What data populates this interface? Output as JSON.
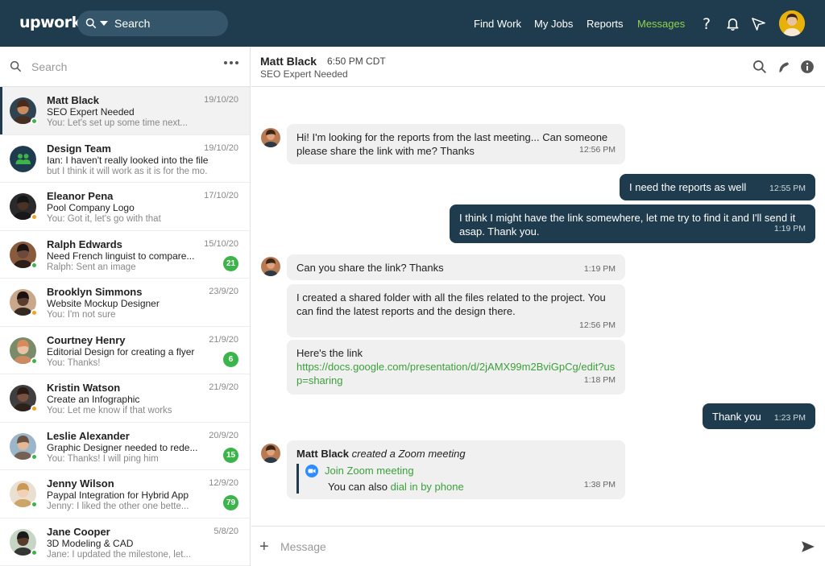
{
  "app": {
    "logo": "upwork",
    "search_placeholder": "Search",
    "nav": [
      "Find Work",
      "My Jobs",
      "Reports",
      "Messages"
    ],
    "active_nav": "Messages",
    "accent": "#1f3c4f",
    "highlight": "#8fd24a"
  },
  "sidebar": {
    "search_placeholder": "Search",
    "conversations": [
      {
        "name": "Matt Black",
        "date": "19/10/20",
        "subject": "SEO Expert Needed",
        "preview": "You: Let's set up some time next...",
        "status": "online",
        "badge": ""
      },
      {
        "name": "Design Team",
        "date": "19/10/20",
        "subject": "Ian: I haven't really looked into the file yet",
        "preview": "but I think it will work as it is for the mo...",
        "status": "",
        "badge": ""
      },
      {
        "name": "Eleanor Pena",
        "date": "17/10/20",
        "subject": "Pool Company Logo",
        "preview": "You: Got it, let's go with that",
        "status": "away",
        "badge": ""
      },
      {
        "name": "Ralph Edwards",
        "date": "15/10/20",
        "subject": "Need French linguist to compare...",
        "preview": "Ralph: Sent an image",
        "status": "online",
        "badge": "21"
      },
      {
        "name": "Brooklyn Simmons",
        "date": "23/9/20",
        "subject": "Website Mockup Designer",
        "preview": "You: I'm not sure",
        "status": "away",
        "badge": ""
      },
      {
        "name": "Courtney Henry",
        "date": "21/9/20",
        "subject": "Editorial Design for creating a flyer",
        "preview": "You: Thanks!",
        "status": "online",
        "badge": "6"
      },
      {
        "name": "Kristin Watson",
        "date": "21/9/20",
        "subject": "Create an Infographic",
        "preview": "You: Let me know if that works",
        "status": "away",
        "badge": ""
      },
      {
        "name": "Leslie Alexander",
        "date": "20/9/20",
        "subject": "Graphic Designer needed to rede...",
        "preview": "You: Thanks! I will ping him",
        "status": "online",
        "badge": "15"
      },
      {
        "name": "Jenny Wilson",
        "date": "12/9/20",
        "subject": "Paypal Integration for Hybrid App",
        "preview": "Jenny: I liked the other one bette...",
        "status": "online",
        "badge": "79"
      },
      {
        "name": "Jane Cooper",
        "date": "5/8/20",
        "subject": "3D Modeling & CAD",
        "preview": "Jane: I updated the milestone, let...",
        "status": "online",
        "badge": ""
      }
    ]
  },
  "chat": {
    "name": "Matt Black",
    "time": "6:50 PM CDT",
    "subject": "SEO Expert Needed",
    "messages": [
      {
        "text": "Hi! I'm looking for the reports from the last meeting... Can someone please share the link with me? Thanks",
        "time": "12:56 PM"
      },
      {
        "text": "I need the reports as well",
        "time": "12:55 PM"
      },
      {
        "text": "I think I might have the link somewhere, let me try to find it and I'll send it asap. Thank you.",
        "time": "1:19 PM"
      },
      {
        "text": "Can you share the link? Thanks",
        "time": "1:19 PM"
      },
      {
        "text": "I created a shared folder with all the files related to the project. You can find the latest reports and the design there.",
        "time": "12:56 PM"
      },
      {
        "text": "Here's the link",
        "link": "https://docs.google.com/presentation/d/2jAMX99m2BviGpCg/edit?usp=sharing",
        "time": "1:18 PM"
      },
      {
        "text": "Thank you",
        "time": "1:23 PM"
      }
    ],
    "zoom": {
      "actor": "Matt Black",
      "action": "created a Zoom meeting",
      "join_label": "Join Zoom meeting",
      "dial_prefix": "You can also",
      "dial_link": "dial in by phone",
      "time": "1:38 PM"
    }
  },
  "composer": {
    "placeholder": "Message"
  }
}
